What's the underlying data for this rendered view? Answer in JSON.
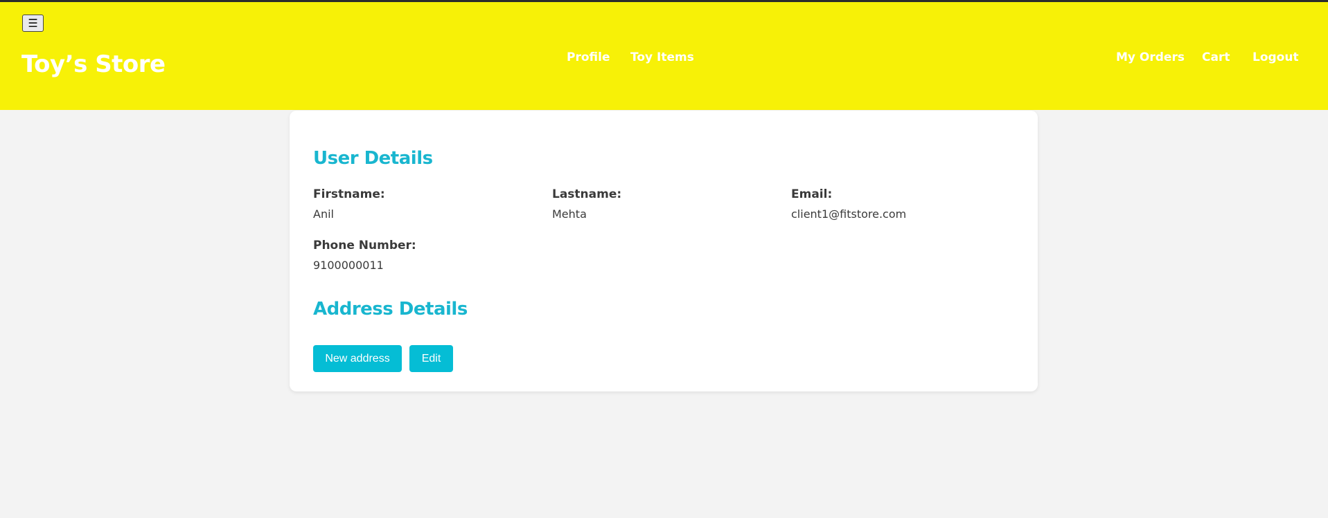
{
  "header": {
    "menu_toggle_icon": "☰",
    "brand": "Toy’s Store",
    "nav_center": [
      "Profile",
      "Toy Items"
    ],
    "nav_right": [
      "My Orders",
      "Cart",
      "Logout"
    ],
    "background_color": "#f7f107"
  },
  "user_details": {
    "title": "User Details",
    "fields": [
      {
        "label": "Firstname:",
        "value": "Anil"
      },
      {
        "label": "Lastname:",
        "value": "Mehta"
      },
      {
        "label": "Email:",
        "value": "client1@fitstore.com"
      },
      {
        "label": "Phone Number:",
        "value": "9100000011"
      }
    ]
  },
  "address_details": {
    "title": "Address Details",
    "buttons": {
      "new_address": "New address",
      "edit": "Edit"
    }
  },
  "colors": {
    "accent": "#19b6cf",
    "button": "#05bdd5",
    "page_background": "#f3f3f3"
  }
}
